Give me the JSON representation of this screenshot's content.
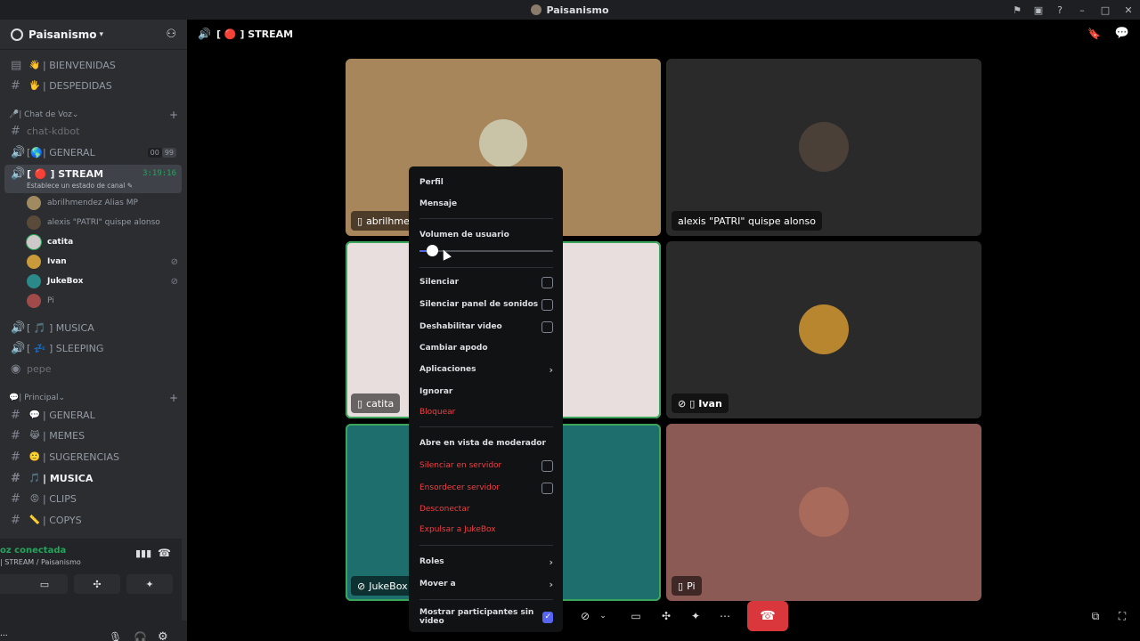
{
  "titlebar": {
    "title": "Paisanismo"
  },
  "server": {
    "name": "Paisanismo"
  },
  "sidebar": {
    "top_channels": [
      {
        "emoji": "👋",
        "label": "| BIENVENIDAS"
      },
      {
        "emoji": "🖐",
        "label": "| DESPEDIDAS"
      }
    ],
    "voice_category": "| Chat de Voz",
    "voice_channels": {
      "kdbot": "chat-kdbot",
      "general": "| GENERAL",
      "general_count_a": "00",
      "general_count_b": "99",
      "stream": "[ 🔴 ] STREAM",
      "stream_time": "3:19:16",
      "stream_status": "Establece un estado de canal",
      "musica": "[ 🎵 ] MUSICA",
      "sleeping": "[ 💤 ] SLEEPING",
      "pepe": "pepe"
    },
    "stream_users": [
      {
        "name": "abrilhmendez Alias MP",
        "bold": false,
        "avatar_color": "#a08a60"
      },
      {
        "name": "alexis \"PATRI\" quispe alonso",
        "bold": false,
        "avatar_color": "#5a4a3a"
      },
      {
        "name": "catita",
        "bold": true,
        "avatar_color": "#cfc8c8"
      },
      {
        "name": "Ivan",
        "bold": true,
        "avatar_color": "#c89a3a"
      },
      {
        "name": "JukeBox",
        "bold": true,
        "avatar_color": "#2a8a8a"
      },
      {
        "name": "Pi",
        "bold": false,
        "avatar_color": "#a04a4a"
      }
    ],
    "main_category": "| Principal",
    "main_channels": [
      {
        "emoji": "💬",
        "label": "| GENERAL",
        "active": false
      },
      {
        "emoji": "😹",
        "label": "| MEMES",
        "active": false
      },
      {
        "emoji": "🙂",
        "label": "| SUGERENCIAS",
        "active": false
      },
      {
        "emoji": "🎵",
        "label": "| MUSICA",
        "active": true
      },
      {
        "emoji": "😡",
        "label": "| CLIPS",
        "active": false
      },
      {
        "emoji": "📏",
        "label": "| COPYS",
        "active": false
      }
    ],
    "voice_connected": "oz conectada",
    "voice_sub": "| STREAM / Paisanismo",
    "user_status": "visible"
  },
  "header": {
    "channel": "[ 🔴 ] STREAM"
  },
  "tiles": [
    {
      "name": "abrilhmen",
      "bg": "#a8865c",
      "avatar_bg": "#c9c3a8",
      "has_mobile": true,
      "speaking": false
    },
    {
      "name": "alexis \"PATRI\" quispe alonso",
      "bg": "#2a2a2a",
      "avatar_bg": "#4a4038",
      "has_mobile": false,
      "speaking": false
    },
    {
      "name": "catita",
      "bg": "#e8dede",
      "avatar_bg": "#e8dede",
      "has_mobile": true,
      "speaking": true
    },
    {
      "name": "Ivan",
      "bg": "#2a2a2a",
      "avatar_bg": "#b8862e",
      "has_mobile": true,
      "speaking": false
    },
    {
      "name": "JukeBox",
      "bg": "#1e6e6e",
      "avatar_bg": "#1e6e6e",
      "has_mobile": false,
      "speaking": true
    },
    {
      "name": "Pi",
      "bg": "#8c5a55",
      "avatar_bg": "#a86a5a",
      "has_mobile": true,
      "speaking": false
    }
  ],
  "menu": {
    "perfil": "Perfil",
    "mensaje": "Mensaje",
    "volumen": "Volumen de usuario",
    "volume_level": 0.1,
    "silenciar": "Silenciar",
    "silenciar_panel": "Silenciar panel de sonidos",
    "deshabilitar_video": "Deshabilitar video",
    "cambiar_apodo": "Cambiar apodo",
    "aplicaciones": "Aplicaciones",
    "ignorar": "Ignorar",
    "bloquear": "Bloquear",
    "moderador": "Abre en vista de moderador",
    "silenciar_servidor": "Silenciar en servidor",
    "ensordecer_servidor": "Ensordecer servidor",
    "desconectar": "Desconectar",
    "expulsar": "Expulsar a JukeBox",
    "roles": "Roles",
    "mover": "Mover a",
    "mostrar_participantes": "Mostrar participantes sin video"
  },
  "colors": {
    "accent": "#5865f2",
    "danger": "#f23f43",
    "online": "#23a55a",
    "end_call": "#da373c"
  }
}
